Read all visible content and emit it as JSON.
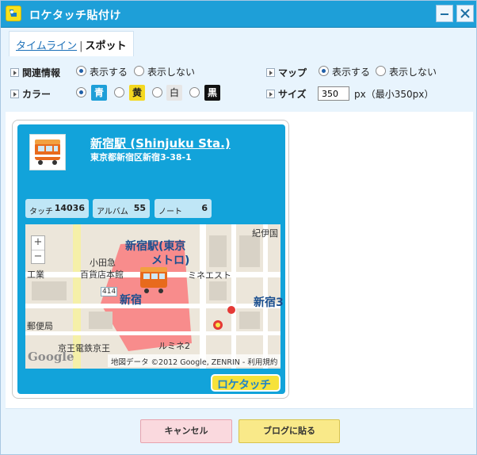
{
  "window": {
    "title": "ロケタッチ貼付け"
  },
  "tabs": {
    "timeline": "タイムライン",
    "separator": "|",
    "spot": "スポット"
  },
  "options": {
    "related_label": "関連情報",
    "map_label": "マップ",
    "color_label": "カラー",
    "size_label": "サイズ",
    "show": "表示する",
    "hide": "表示しない",
    "color_blue": "青",
    "color_yellow": "黄",
    "color_white": "白",
    "color_black": "黒",
    "size_value": "350",
    "size_unit": "px（最小350px）"
  },
  "spot": {
    "title": "新宿駅 (Shinjuku Sta.)",
    "address": "東京都新宿区新宿3-38-1",
    "stats": {
      "touch_label": "タッチ",
      "touch_value": "14036",
      "album_label": "アルバム",
      "album_value": "55",
      "note_label": "ノート",
      "note_value": "6"
    }
  },
  "map": {
    "labels": {
      "shinjuku_station": "新宿駅(東京",
      "metro": "メトロ)",
      "shinjuku": "新宿",
      "odakyu": "小田急",
      "dept": "百貨店本館",
      "lumine_est": "ミネエスト",
      "lumine2": "ルミネ2",
      "keio": "京王電鉄京王",
      "post": "郵便局",
      "kishu": "紀伊国",
      "route": "414",
      "shinjuku3": "新宿3",
      "kou": "工業"
    },
    "zoom_in": "+",
    "zoom_out": "−",
    "google": "Google",
    "attribution": "地図データ ©2012 Google, ZENRIN - 利用規約"
  },
  "brand": "ロケタッチ",
  "buttons": {
    "cancel": "キャンセル",
    "paste": "ブログに貼る"
  },
  "colors": {
    "accent": "#1e9fd8",
    "card": "#12a3da"
  }
}
